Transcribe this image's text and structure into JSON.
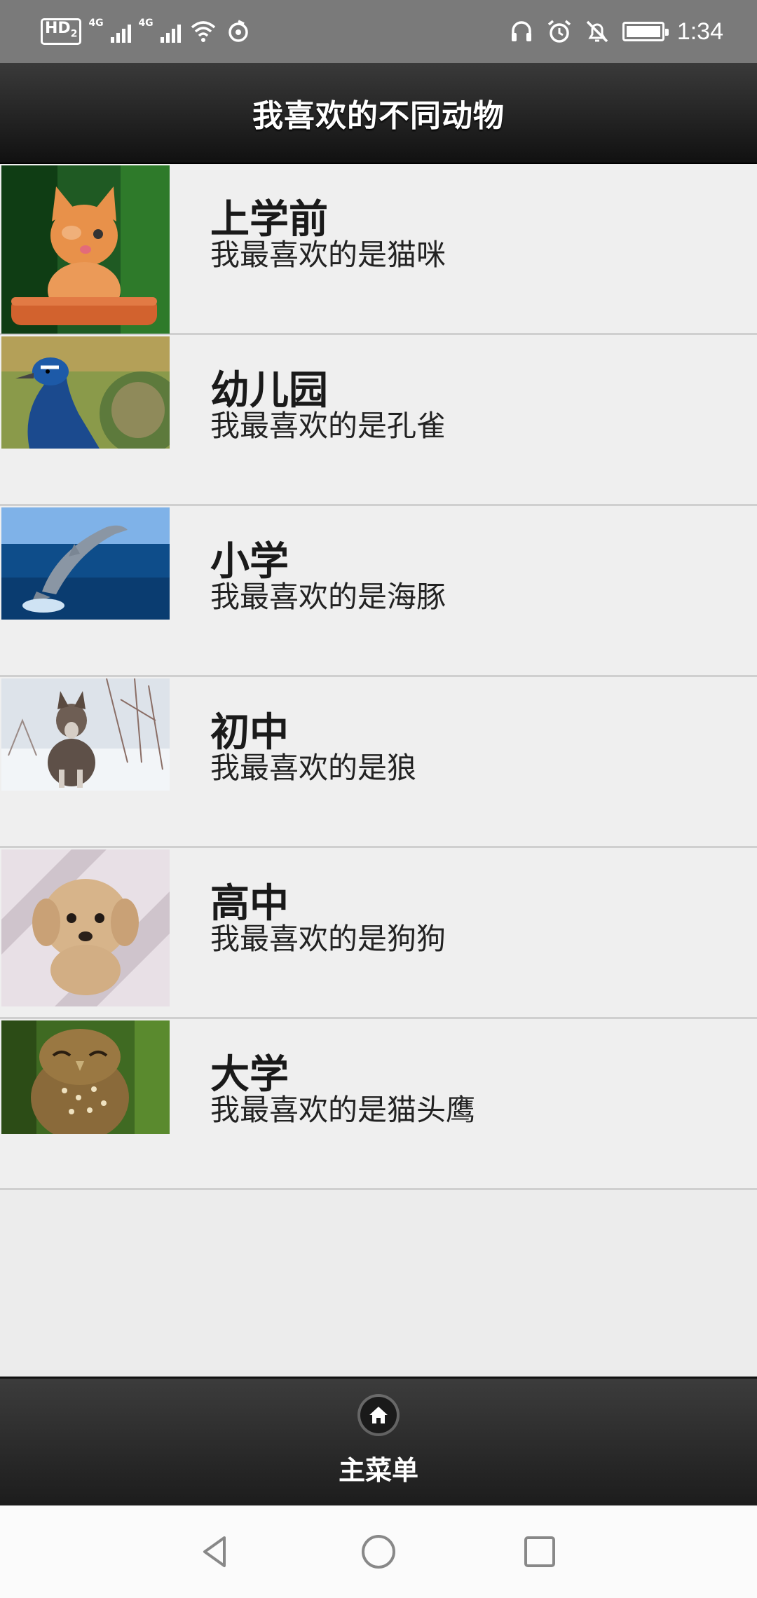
{
  "status_bar": {
    "hd_label": "HD",
    "hd_sub": "2",
    "sim1_label": "4G",
    "sim2_label": "4G",
    "time": "1:34",
    "icons": [
      "headphones-icon",
      "alarm-icon",
      "mute-bell-icon",
      "battery-charging-icon",
      "wifi-icon",
      "sync-icon"
    ]
  },
  "header": {
    "title": "我喜欢的不同动物"
  },
  "items": [
    {
      "title": "上学前",
      "subtitle": "我最喜欢的是猫咪",
      "image": "kitten-photo"
    },
    {
      "title": "幼儿园",
      "subtitle": "我最喜欢的是孔雀",
      "image": "peacock-photo"
    },
    {
      "title": "小学",
      "subtitle": "我最喜欢的是海豚",
      "image": "dolphin-photo"
    },
    {
      "title": "初中",
      "subtitle": "我最喜欢的是狼",
      "image": "wolf-photo"
    },
    {
      "title": "高中",
      "subtitle": "我最喜欢的是狗狗",
      "image": "puppy-photo"
    },
    {
      "title": "大学",
      "subtitle": "我最喜欢的是猫头鹰",
      "image": "owl-photo"
    }
  ],
  "bottom_nav": {
    "label": "主菜单",
    "icon": "home-icon"
  },
  "system_nav": {
    "icons": [
      "back-icon",
      "home-circle-icon",
      "recents-icon"
    ]
  },
  "colors": {
    "header_bg": "#1a1a1a",
    "list_bg": "#efefef",
    "divider": "#cfcfcf",
    "status_bar_bg": "#7a7a7a"
  }
}
